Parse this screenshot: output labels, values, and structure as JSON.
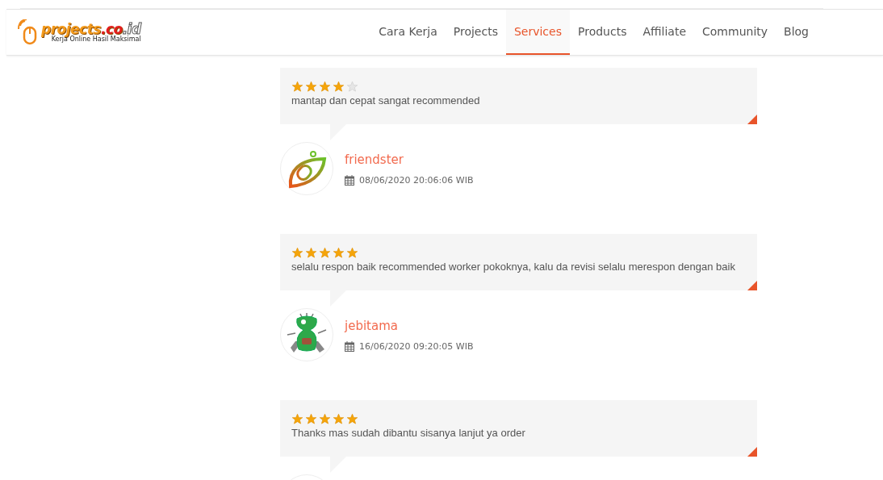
{
  "logo": {
    "name_parts": [
      "projects",
      ".co",
      ".id"
    ],
    "tagline": "Kerja Online Hasil Maksimal"
  },
  "nav": [
    {
      "label": "Cara Kerja",
      "selected": false
    },
    {
      "label": "Projects",
      "selected": false
    },
    {
      "label": "Services",
      "selected": true
    },
    {
      "label": "Products",
      "selected": false
    },
    {
      "label": "Affiliate",
      "selected": false
    },
    {
      "label": "Community",
      "selected": false
    },
    {
      "label": "Blog",
      "selected": false
    }
  ],
  "reviews": [
    {
      "stars": 4,
      "text": "mantap dan cepat sangat recommended",
      "author": {
        "name": "friendster",
        "date": "08/06/2020 20:06:06 WIB",
        "kind": "leaf"
      }
    },
    {
      "stars": 5,
      "text": "selalu respon baik recommended worker pokoknya, kalu da revisi selalu merespon dengan baik",
      "author": {
        "name": "jebitama",
        "date": "16/06/2020 09:20:05 WIB",
        "kind": "creature"
      }
    },
    {
      "stars": 5,
      "text": "Thanks mas sudah dibantu sisanya lanjut ya order"
    }
  ]
}
